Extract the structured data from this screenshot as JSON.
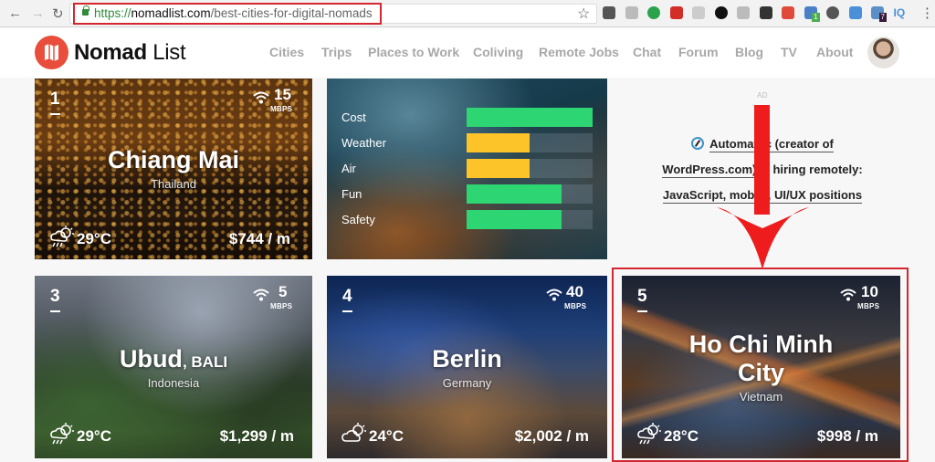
{
  "browser": {
    "url_scheme": "https://",
    "url_host": "nomadlist.com",
    "url_path": "/best-cities-for-digital-nomads",
    "back_icon": "←",
    "forward_icon": "→",
    "reload_icon": "↻",
    "star_icon": "☆",
    "menu_icon": "⋮",
    "extensions": [
      {
        "name": "pocket-extension-icon",
        "color": "#555555"
      },
      {
        "name": "camera-extension-icon",
        "color": "#bbbbbb"
      },
      {
        "name": "pushbullet-extension-icon",
        "color": "#2ba24c"
      },
      {
        "name": "lastpass-extension-icon",
        "color": "#d32d27"
      },
      {
        "name": "clipboard-extension-icon",
        "color": "#cccccc"
      },
      {
        "name": "circle-extension-icon",
        "color": "#111111"
      },
      {
        "name": "drive-extension-icon",
        "color": "#bbbbbb"
      },
      {
        "name": "checkmark-extension-icon",
        "color": "#333333"
      },
      {
        "name": "cart-extension-icon",
        "color": "#e04a3b"
      },
      {
        "name": "code-extension-icon",
        "color": "#4a80c8",
        "badge": "1"
      },
      {
        "name": "info-extension-icon",
        "color": "#555555"
      },
      {
        "name": "tab-extension-icon",
        "color": "#4a90d8"
      },
      {
        "name": "ghost-extension-icon",
        "color": "#5a8fc8",
        "badge": "7"
      },
      {
        "name": "iq-extension-icon",
        "color": "#4a90d8",
        "text": "IQ"
      }
    ]
  },
  "header": {
    "logo_bold": "Nomad",
    "logo_light": "List",
    "nav": [
      "Cities",
      "Trips",
      "Places to Work",
      "Coliving",
      "Remote Jobs",
      "Chat",
      "Forum",
      "Blog",
      "TV",
      "About"
    ]
  },
  "cards": [
    {
      "rank": "1",
      "city": "Chiang Mai",
      "city_suffix": "",
      "country": "Thailand",
      "speed": "15",
      "speed_unit": "MBPS",
      "weather": "rain-sun",
      "temp": "29°C",
      "cost": "$744 / m"
    },
    {
      "rank": "3",
      "city": "Ubud",
      "city_suffix": ", BALI",
      "country": "Indonesia",
      "speed": "5",
      "speed_unit": "MBPS",
      "weather": "rain-sun",
      "temp": "29°C",
      "cost": "$1,299 / m"
    },
    {
      "rank": "4",
      "city": "Berlin",
      "city_suffix": "",
      "country": "Germany",
      "speed": "40",
      "speed_unit": "MBPS",
      "weather": "cloud-sun",
      "temp": "24°C",
      "cost": "$2,002 / m"
    },
    {
      "rank": "5",
      "city": "Ho Chi Minh City",
      "city_suffix": "",
      "country": "Vietnam",
      "speed": "10",
      "speed_unit": "MBPS",
      "weather": "rain-sun",
      "temp": "28°C",
      "cost": "$998 / m"
    }
  ],
  "scores": {
    "colors": {
      "good": "#2ed573",
      "medium": "#fdc42a"
    },
    "items": [
      {
        "label": "Cost",
        "fraction": 1.0,
        "level": "good"
      },
      {
        "label": "Weather",
        "fraction": 0.5,
        "level": "medium"
      },
      {
        "label": "Air",
        "fraction": 0.5,
        "level": "medium"
      },
      {
        "label": "Fun",
        "fraction": 0.75,
        "level": "good"
      },
      {
        "label": "Safety",
        "fraction": 0.75,
        "level": "good"
      }
    ]
  },
  "ad": {
    "label": "AD",
    "line1": "Automattic (creator of",
    "line2a": "WordPress.com)",
    "line2b": " is hiring remotely:",
    "line3": "JavaScript, mobile, UI/UX positions"
  },
  "annotation": {
    "color": "#ee1c1c"
  }
}
